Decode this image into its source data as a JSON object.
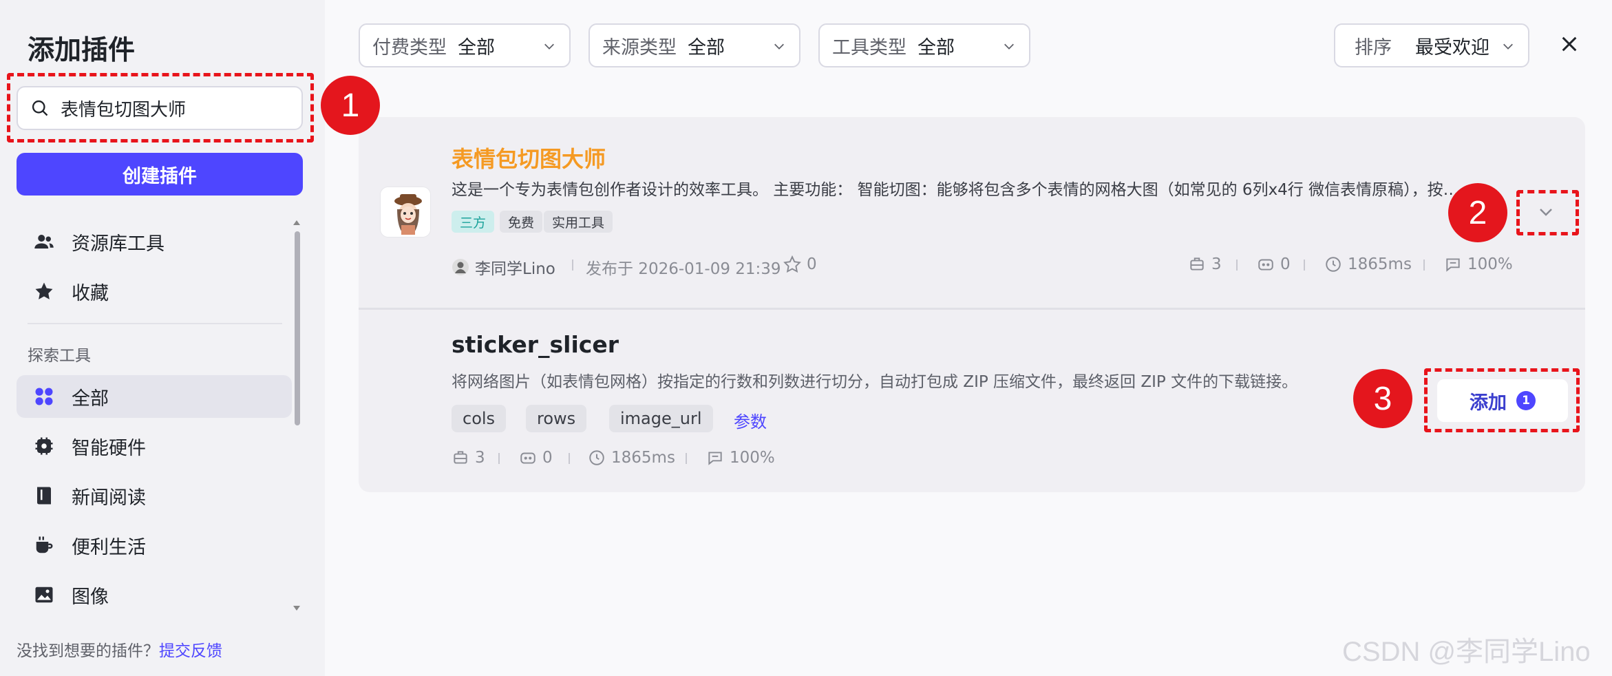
{
  "sidebar": {
    "title": "添加插件",
    "search_value": "表情包切图大师",
    "create_label": "创建插件",
    "nav_top": [
      {
        "label": "资源库工具",
        "icon": "users-icon"
      },
      {
        "label": "收藏",
        "icon": "star-icon"
      }
    ],
    "section_label": "探索工具",
    "nav_explore": [
      {
        "label": "全部",
        "icon": "grid-icon"
      },
      {
        "label": "智能硬件",
        "icon": "chip-icon"
      },
      {
        "label": "新闻阅读",
        "icon": "book-icon"
      },
      {
        "label": "便利生活",
        "icon": "cup-icon"
      },
      {
        "label": "图像",
        "icon": "image-icon"
      }
    ],
    "footer_text": "没找到想要的插件？",
    "footer_link": "提交反馈"
  },
  "filters": [
    {
      "label": "付费类型",
      "value": "全部"
    },
    {
      "label": "来源类型",
      "value": "全部"
    },
    {
      "label": "工具类型",
      "value": "全部"
    }
  ],
  "sort": {
    "label": "排序",
    "value": "最受欢迎"
  },
  "plugin": {
    "title": "表情包切图大师",
    "description": "这是一个专为表情包创作者设计的效率工具。 主要功能： 智能切图：能够将包含多个表情的网格大图（如常见的 6列x4行 微信表情原稿），按…",
    "tags": [
      "三方",
      "免费",
      "实用工具"
    ],
    "author": "李同学Lino",
    "published": "发布于 2026-01-09 21:39",
    "stars": "0",
    "stats": {
      "tools": "3",
      "bots": "0",
      "latency": "1865ms",
      "success": "100%"
    }
  },
  "tool": {
    "name": "sticker_slicer",
    "description": "将网络图片（如表情包网格）按指定的行数和列数进行切分，自动打包成 ZIP 压缩文件，最终返回 ZIP 文件的下载链接。",
    "params": [
      "cols",
      "rows",
      "image_url"
    ],
    "params_link": "参数",
    "stats": {
      "tools": "3",
      "bots": "0",
      "latency": "1865ms",
      "success": "100%"
    },
    "add_label": "添加",
    "add_count": "1"
  },
  "annotations": [
    "1",
    "2",
    "3"
  ],
  "watermark": "CSDN @李同学Lino"
}
